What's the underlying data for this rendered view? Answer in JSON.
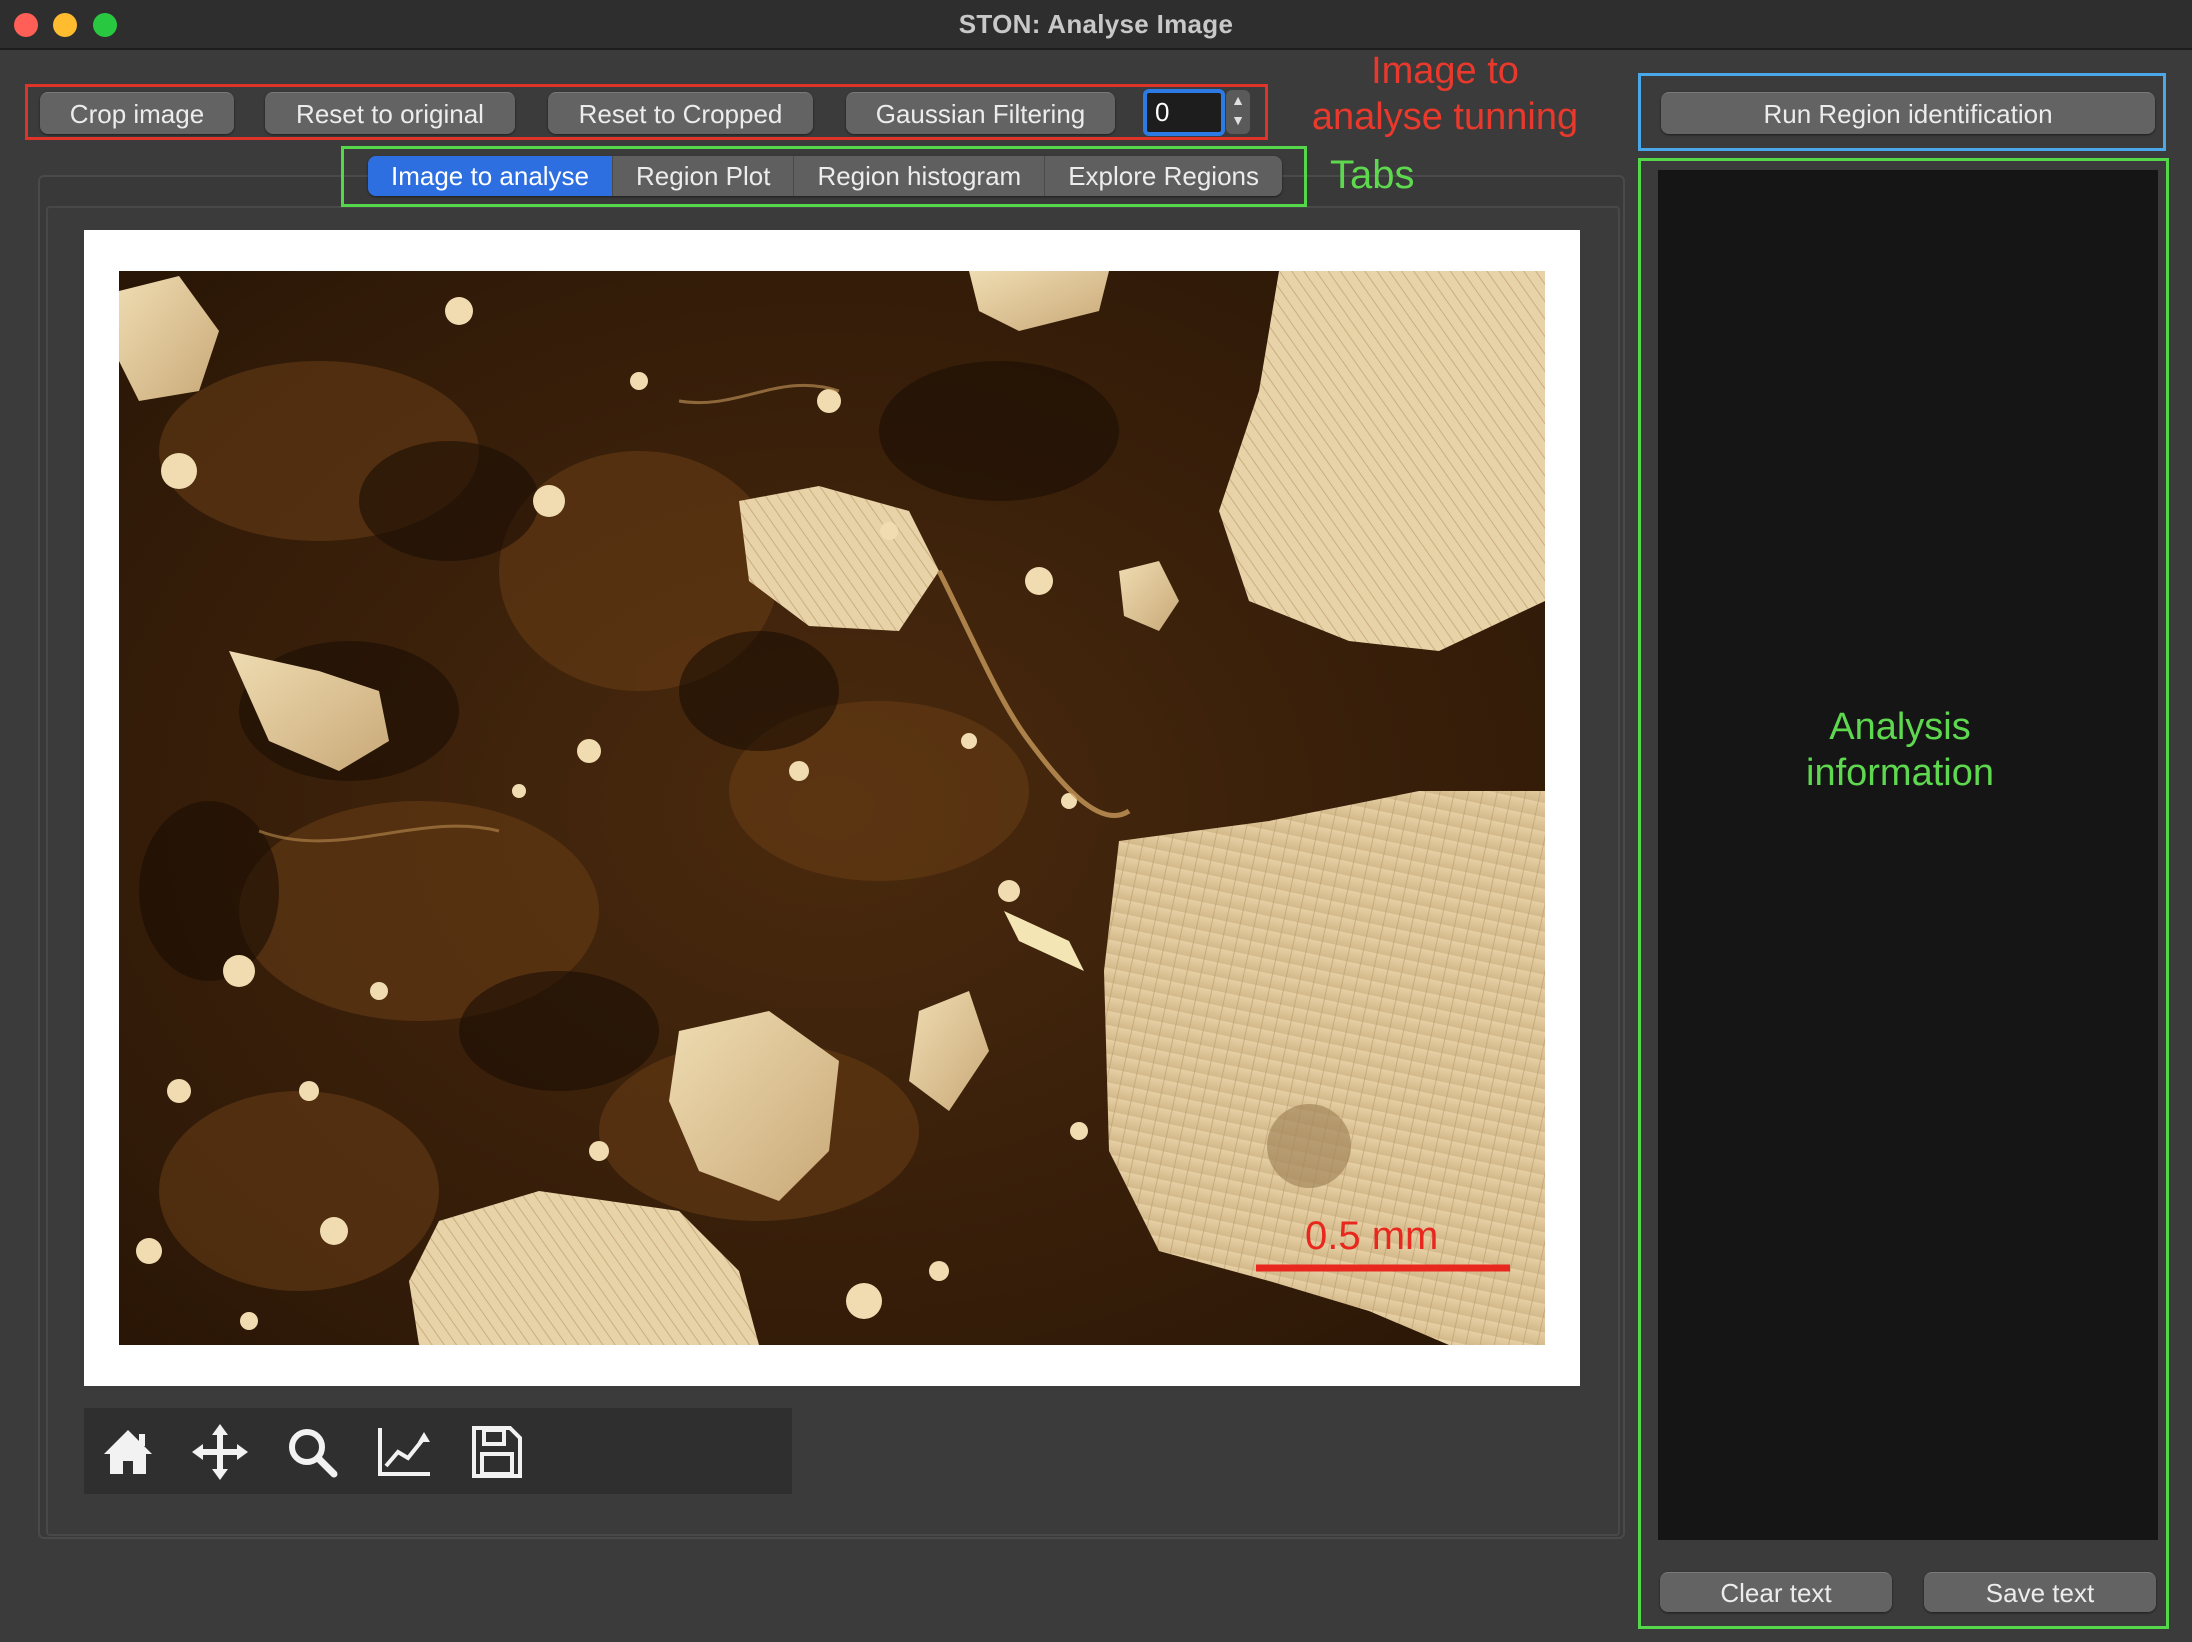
{
  "window": {
    "title": "STON: Analyse Image"
  },
  "toolbar": {
    "crop_label": "Crop image",
    "reset_original_label": "Reset to original",
    "reset_cropped_label": "Reset to Cropped",
    "gaussian_label": "Gaussian Filtering",
    "gaussian_value": "0",
    "run_region_label": "Run Region identification"
  },
  "tabs": [
    {
      "label": "Image to analyse",
      "active": true
    },
    {
      "label": "Region Plot",
      "active": false
    },
    {
      "label": "Region histogram",
      "active": false
    },
    {
      "label": "Explore Regions",
      "active": false
    }
  ],
  "image": {
    "scale_bar_label": "0.5 mm",
    "scale_bar_color": "#e8281e"
  },
  "plot_toolbar": {
    "icons": [
      "home-icon",
      "pan-icon",
      "zoom-icon",
      "subplots-icon",
      "save-icon"
    ]
  },
  "side_panel": {
    "clear_label": "Clear text",
    "save_label": "Save text"
  },
  "annotations": {
    "tuning_line1": "Image to",
    "tuning_line2": "analyse tunning",
    "tabs": "Tabs",
    "analysis_line1": "Analysis",
    "analysis_line2": "information",
    "colors": {
      "red": "#e8392c",
      "green": "#54d84a",
      "blue": "#4aa8e8"
    }
  }
}
